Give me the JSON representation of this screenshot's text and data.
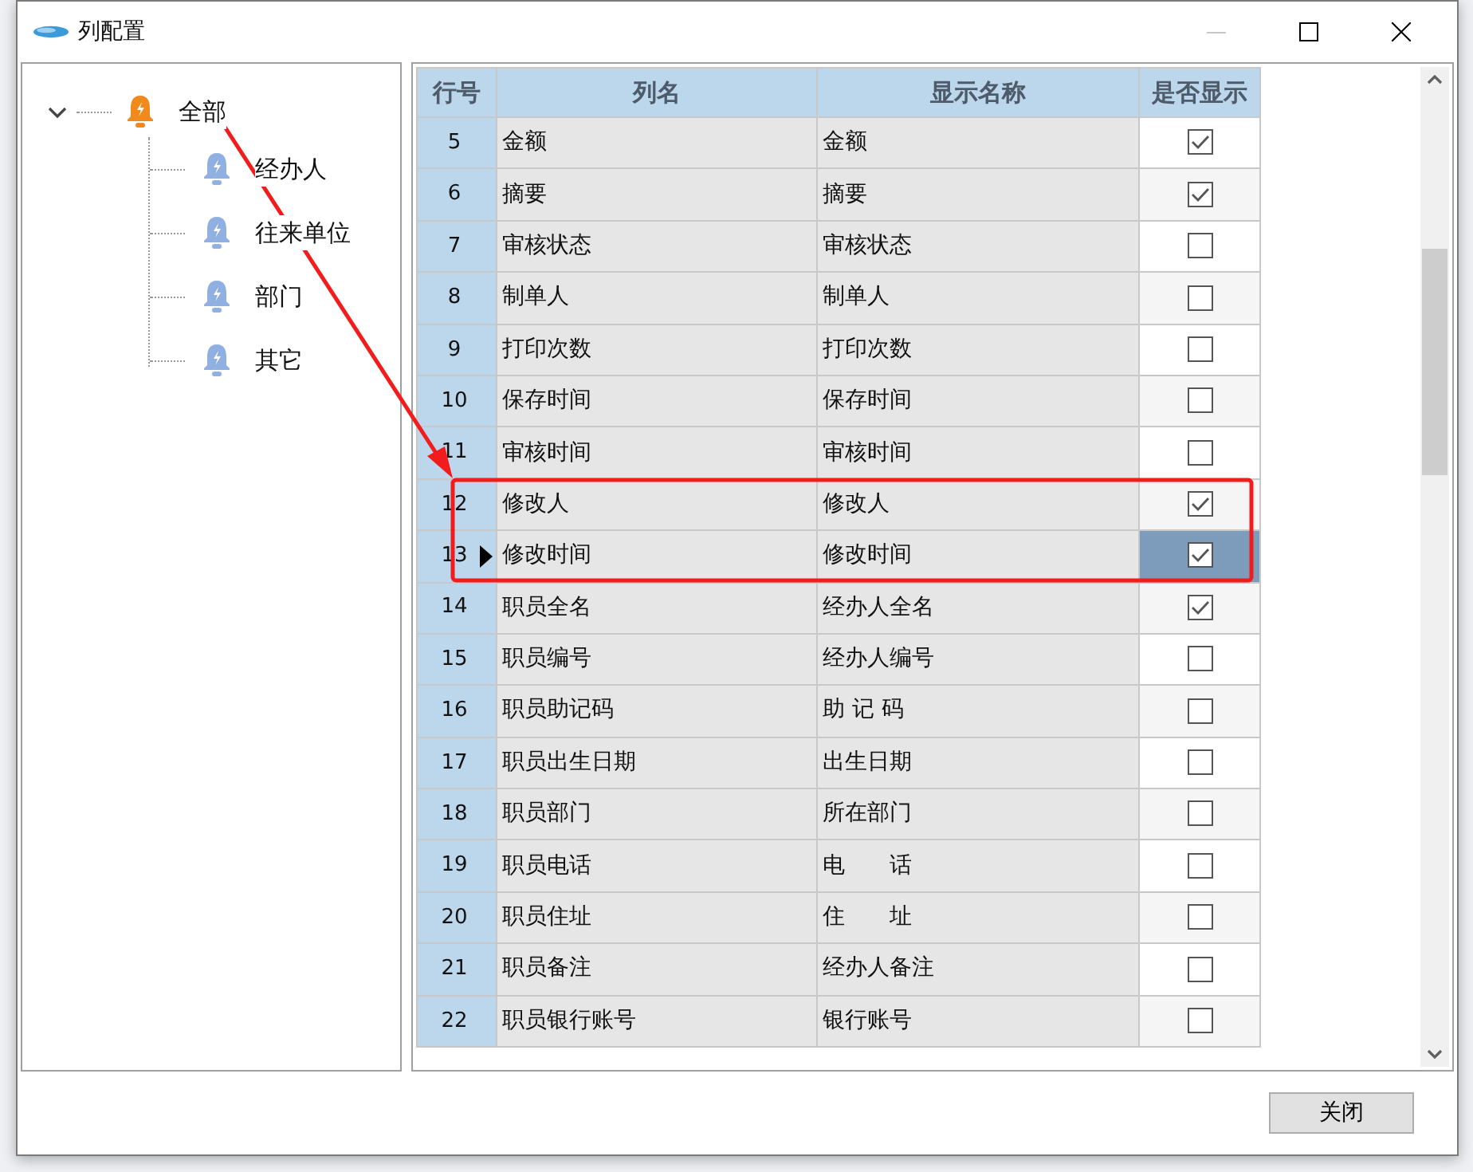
{
  "window": {
    "title": "列配置",
    "minimize_disabled": true
  },
  "tree": [
    {
      "label": "全部",
      "expanded": true,
      "color": "#f08a1c",
      "children": [
        {
          "label": "经办人",
          "color": "#8fb0e0"
        },
        {
          "label": "往来单位",
          "color": "#8fb0e0"
        },
        {
          "label": "部门",
          "color": "#8fb0e0"
        },
        {
          "label": "其它",
          "color": "#8fb0e0"
        }
      ]
    }
  ],
  "table": {
    "columns": [
      "行号",
      "列名",
      "显示名称",
      "是否显示"
    ],
    "rows": [
      {
        "no": "5",
        "name": "金额",
        "display": "金额",
        "checked": true,
        "selected": false
      },
      {
        "no": "6",
        "name": "摘要",
        "display": "摘要",
        "checked": true,
        "selected": false
      },
      {
        "no": "7",
        "name": "审核状态",
        "display": "审核状态",
        "checked": false,
        "selected": false
      },
      {
        "no": "8",
        "name": "制单人",
        "display": "制单人",
        "checked": false,
        "selected": false
      },
      {
        "no": "9",
        "name": "打印次数",
        "display": "打印次数",
        "checked": false,
        "selected": false
      },
      {
        "no": "10",
        "name": "保存时间",
        "display": "保存时间",
        "checked": false,
        "selected": false
      },
      {
        "no": "11",
        "name": "审核时间",
        "display": "审核时间",
        "checked": false,
        "selected": false
      },
      {
        "no": "12",
        "name": "修改人",
        "display": "修改人",
        "checked": true,
        "selected": false
      },
      {
        "no": "13",
        "name": "修改时间",
        "display": "修改时间",
        "checked": true,
        "selected": true
      },
      {
        "no": "14",
        "name": "职员全名",
        "display": "经办人全名",
        "checked": true,
        "selected": false
      },
      {
        "no": "15",
        "name": "职员编号",
        "display": "经办人编号",
        "checked": false,
        "selected": false
      },
      {
        "no": "16",
        "name": "职员助记码",
        "display": "助 记 码",
        "checked": false,
        "selected": false
      },
      {
        "no": "17",
        "name": "职员出生日期",
        "display": "出生日期",
        "checked": false,
        "selected": false
      },
      {
        "no": "18",
        "name": "职员部门",
        "display": "所在部门",
        "checked": false,
        "selected": false
      },
      {
        "no": "19",
        "name": "职员电话",
        "display": "电　　话",
        "checked": false,
        "selected": false
      },
      {
        "no": "20",
        "name": "职员住址",
        "display": "住　　址",
        "checked": false,
        "selected": false
      },
      {
        "no": "21",
        "name": "职员备注",
        "display": "经办人备注",
        "checked": false,
        "selected": false
      },
      {
        "no": "22",
        "name": "职员银行账号",
        "display": "银行账号",
        "checked": false,
        "selected": false
      }
    ]
  },
  "annotations": {
    "arrow": true,
    "box": true
  },
  "buttons": [
    "关闭"
  ]
}
